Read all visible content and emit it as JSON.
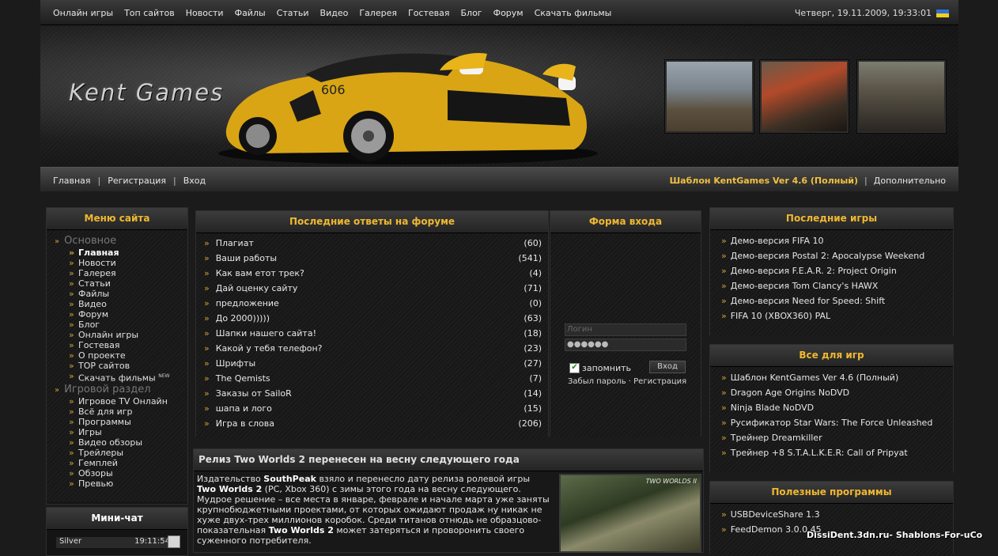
{
  "topnav": [
    "Онлайн игры",
    "Топ сайтов",
    "Новости",
    "Файлы",
    "Статьи",
    "Видео",
    "Галерея",
    "Гостевая",
    "Блог",
    "Форум",
    "Скачать фильмы"
  ],
  "datetime": "Четверг, 19.11.2009, 19:33:01",
  "logo": "Kent Games",
  "subnav": {
    "home": "Главная",
    "register": "Регистрация",
    "login": "Вход"
  },
  "template_link": "Шаблон KentGames Ver 4.6 (Полный)",
  "extra_link": "Дополнительно",
  "menu": {
    "title": "Меню сайта",
    "group1": "Основное",
    "items1": [
      "Главная",
      "Новости",
      "Галерея",
      "Статьи",
      "Файлы",
      "Видео",
      "Форум",
      "Блог",
      "Онлайн игры",
      "Гостевая",
      "О проекте",
      "TOP сайтов",
      "Скачать фильмы"
    ],
    "new_badge": "NEW",
    "group2": "Игровой раздел",
    "items2": [
      "Игровое TV Онлайн",
      "Всё для игр",
      "Программы",
      "Игры",
      "Видео обзоры",
      "Трейлеры",
      "Гемплей",
      "Обзоры",
      "Превью"
    ]
  },
  "chat": {
    "title": "Мини-чат",
    "user": "Silver",
    "time": "19:11:54"
  },
  "forum": {
    "title": "Последние ответы на форуме",
    "rows": [
      {
        "t": "Плагиат",
        "n": "(60)"
      },
      {
        "t": "Ваши работы",
        "n": "(541)"
      },
      {
        "t": "Как вам етот трек?",
        "n": "(4)"
      },
      {
        "t": "Дай оценку сайту",
        "n": "(71)"
      },
      {
        "t": "предложение",
        "n": "(0)"
      },
      {
        "t": "До 2000)))))",
        "n": "(63)"
      },
      {
        "t": "Шапки нашего сайта!",
        "n": "(18)"
      },
      {
        "t": "Какой у тебя телефон?",
        "n": "(23)"
      },
      {
        "t": "Шрифты",
        "n": "(27)"
      },
      {
        "t": "The Qemists",
        "n": "(7)"
      },
      {
        "t": "Заказы от SailoR",
        "n": "(14)"
      },
      {
        "t": "шапа и лого",
        "n": "(15)"
      },
      {
        "t": "Игра в слова",
        "n": "(206)"
      }
    ]
  },
  "login": {
    "title": "Форма входа",
    "login_ph": "Логин",
    "password_mask": "●●●●●●",
    "remember": "запомнить",
    "button": "Вход",
    "forgot": "Забыл пароль",
    "register": "Регистрация"
  },
  "news": {
    "title": "Релиз Two Worlds 2 перенесен на весну следующего года",
    "p1a": "Издательство ",
    "p1b": "SouthPeak",
    "p1c": " взяло и перенесло дату релиза ролевой игры ",
    "p1d": "Two Worlds 2",
    "p1e": " (PC, Xbox 360) с зимы этого года на весну следующего. Мудрое решение – все места в январе, феврале и начале марта уже заняты крупнобюджетными проектами, от которых ожидают продаж ну никак не хуже двух-трех миллионов коробок. Среди титанов отнюдь не образцово-показательная ",
    "p1f": "Two Worlds 2",
    "p1g": " может затеряться и проворонить своего суженного потребителя.",
    "img_tag": "TWO WORLDS II"
  },
  "games": {
    "title": "Последние игры",
    "items": [
      "Демо-версия FIFA 10",
      "Демо-версия Postal 2: Apocalypse Weekend",
      "Демо-версия F.E.A.R. 2: Project Origin",
      "Демо-версия Tom Clancy's HAWX",
      "Демо-версия Need for Speed: Shift",
      "FIFA 10 (XBOX360) PAL"
    ]
  },
  "forgames": {
    "title": "Все для игр",
    "items": [
      "Шаблон KentGames Ver 4.6 (Полный)",
      "Dragon Age Origins NoDVD",
      "Ninja Blade NoDVD",
      "Русификатор Star Wars: The Force Unleashed",
      "Трейнер Dreamkiller",
      "Трейнер +8 S.T.A.L.K.E.R: Call of Pripyat"
    ]
  },
  "progs": {
    "title": "Полезные программы",
    "items": [
      "USBDeviceShare 1.3",
      "FeedDemon 3.0.0.45"
    ]
  },
  "credit": "DissiDent.3dn.ru- Shablons-For-uCo",
  "colors": {
    "accent": "#f0b830",
    "bg": "#1b1b1b"
  }
}
